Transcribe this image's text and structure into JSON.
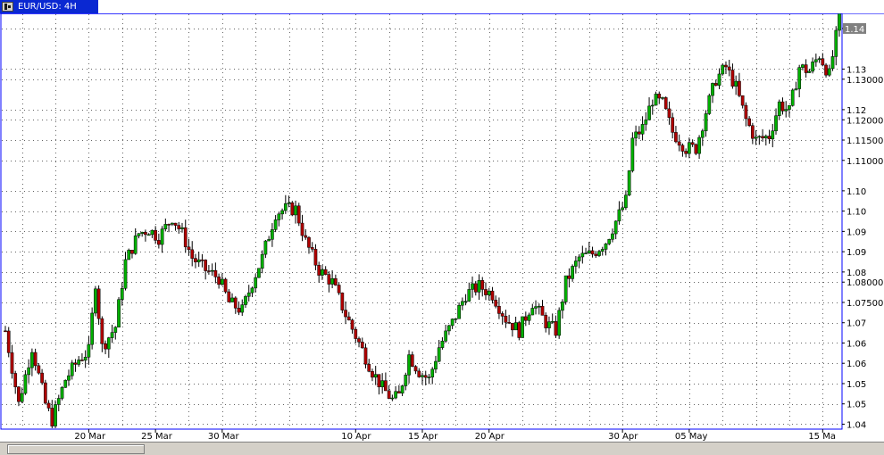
{
  "window": {
    "tab_title": "EUR/USD: 4H",
    "tab_icon": "chart-window-icon"
  },
  "colors": {
    "bull": "#00b000",
    "bear": "#b00000",
    "wick": "#000000",
    "grid": "#000000",
    "axis": "#0000ff",
    "price_marker_bg": "#808080",
    "price_marker_text": "#ffffff",
    "tab_active": "#0a28d2"
  },
  "chart_data": {
    "type": "candlestick",
    "symbol": "EUR/USD",
    "timeframe": "4H",
    "current_price_label": "1.14",
    "y_ticks": [
      {
        "value": 1.1425,
        "label": "1.14"
      },
      {
        "value": 1.1325,
        "label": "1.13"
      },
      {
        "value": 1.13,
        "label": "1.13000"
      },
      {
        "value": 1.1225,
        "label": "1.12"
      },
      {
        "value": 1.12,
        "label": "1.12000"
      },
      {
        "value": 1.115,
        "label": "1.11500"
      },
      {
        "value": 1.11,
        "label": "1.11000"
      },
      {
        "value": 1.1025,
        "label": "1.10"
      },
      {
        "value": 1.0975,
        "label": "1.10"
      },
      {
        "value": 1.0925,
        "label": "1.09"
      },
      {
        "value": 1.0875,
        "label": "1.09"
      },
      {
        "value": 1.0825,
        "label": "1.08"
      },
      {
        "value": 1.08,
        "label": "1.08000"
      },
      {
        "value": 1.075,
        "label": "1.07500"
      },
      {
        "value": 1.07,
        "label": "1.07"
      },
      {
        "value": 1.065,
        "label": "1.06"
      },
      {
        "value": 1.06,
        "label": "1.06"
      },
      {
        "value": 1.055,
        "label": "1.05"
      },
      {
        "value": 1.05,
        "label": "1.05"
      },
      {
        "value": 1.045,
        "label": "1.04"
      }
    ],
    "ylim": [
      1.044,
      1.146
    ],
    "x_labels": [
      {
        "label": "20 Mar",
        "index": 25
      },
      {
        "label": "25 Mar",
        "index": 45
      },
      {
        "label": "30 Mar",
        "index": 65
      },
      {
        "label": "10 Apr",
        "index": 105
      },
      {
        "label": "15 Apr",
        "index": 125
      },
      {
        "label": "20 Apr",
        "index": 145
      },
      {
        "label": "30 Apr",
        "index": 185
      },
      {
        "label": "05 May",
        "index": 205
      },
      {
        "label": "15 Ma",
        "index": 245
      }
    ],
    "bar_count": 251,
    "path_points": [
      [
        0,
        1.068
      ],
      [
        4,
        1.05
      ],
      [
        8,
        1.064
      ],
      [
        12,
        1.05
      ],
      [
        14,
        1.046
      ],
      [
        18,
        1.056
      ],
      [
        22,
        1.061
      ],
      [
        25,
        1.063
      ],
      [
        27,
        1.08
      ],
      [
        29,
        1.064
      ],
      [
        33,
        1.069
      ],
      [
        36,
        1.085
      ],
      [
        40,
        1.092
      ],
      [
        43,
        1.093
      ],
      [
        46,
        1.091
      ],
      [
        50,
        1.096
      ],
      [
        53,
        1.092
      ],
      [
        56,
        1.086
      ],
      [
        60,
        1.083
      ],
      [
        64,
        1.081
      ],
      [
        67,
        1.075
      ],
      [
        71,
        1.073
      ],
      [
        74,
        1.08
      ],
      [
        77,
        1.086
      ],
      [
        81,
        1.097
      ],
      [
        84,
        1.098
      ],
      [
        87,
        1.098
      ],
      [
        90,
        1.09
      ],
      [
        94,
        1.083
      ],
      [
        98,
        1.08
      ],
      [
        102,
        1.072
      ],
      [
        106,
        1.065
      ],
      [
        110,
        1.058
      ],
      [
        113,
        1.054
      ],
      [
        116,
        1.051
      ],
      [
        118,
        1.052
      ],
      [
        121,
        1.062
      ],
      [
        124,
        1.058
      ],
      [
        127,
        1.056
      ],
      [
        130,
        1.064
      ],
      [
        134,
        1.07
      ],
      [
        138,
        1.077
      ],
      [
        142,
        1.079
      ],
      [
        146,
        1.077
      ],
      [
        150,
        1.071
      ],
      [
        154,
        1.068
      ],
      [
        158,
        1.075
      ],
      [
        162,
        1.07
      ],
      [
        165,
        1.068
      ],
      [
        168,
        1.08
      ],
      [
        172,
        1.086
      ],
      [
        176,
        1.087
      ],
      [
        180,
        1.09
      ],
      [
        183,
        1.095
      ],
      [
        186,
        1.1
      ],
      [
        188,
        1.115
      ],
      [
        191,
        1.118
      ],
      [
        194,
        1.125
      ],
      [
        197,
        1.124
      ],
      [
        200,
        1.117
      ],
      [
        204,
        1.113
      ],
      [
        207,
        1.113
      ],
      [
        210,
        1.122
      ],
      [
        213,
        1.13
      ],
      [
        216,
        1.133
      ],
      [
        219,
        1.128
      ],
      [
        222,
        1.12
      ],
      [
        225,
        1.115
      ],
      [
        229,
        1.116
      ],
      [
        232,
        1.124
      ],
      [
        235,
        1.122
      ],
      [
        238,
        1.133
      ],
      [
        241,
        1.132
      ],
      [
        244,
        1.136
      ],
      [
        247,
        1.131
      ],
      [
        250,
        1.145
      ]
    ]
  },
  "scrollbar": {
    "thumb_position": 0.0
  }
}
